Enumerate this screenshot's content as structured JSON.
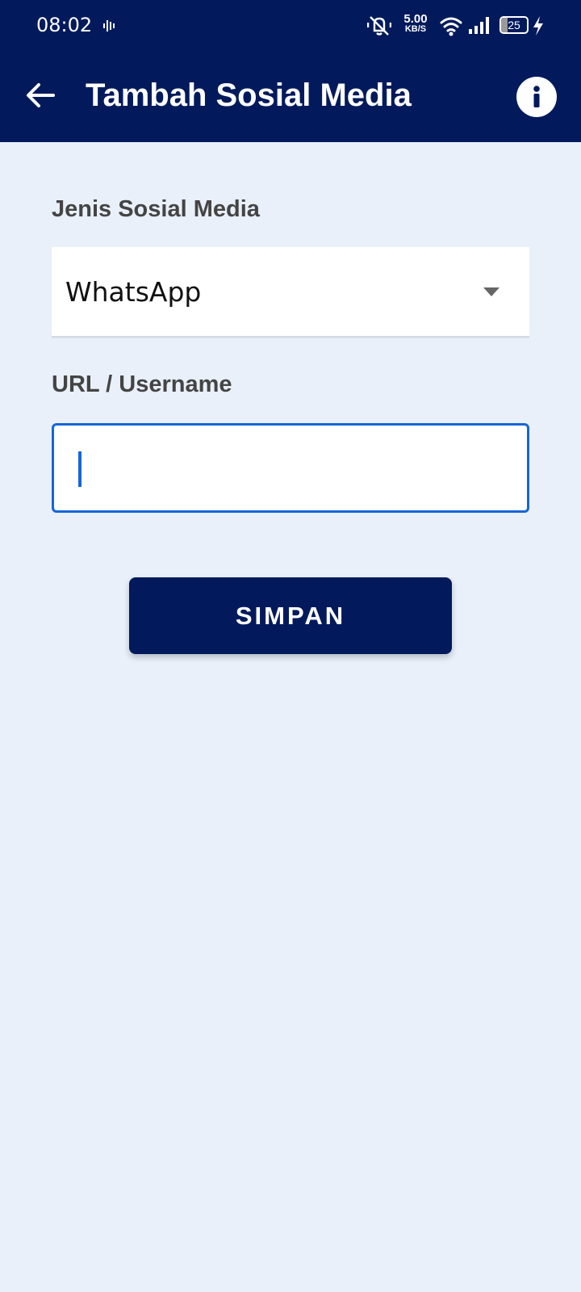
{
  "status_bar": {
    "time": "08:02",
    "network_speed_value": "5.00",
    "network_speed_unit": "KB/S",
    "battery_level": "25",
    "icons": [
      "voice-activity-icon",
      "mute-vibrate-icon",
      "wifi-icon",
      "signal-icon",
      "battery-icon",
      "charging-icon"
    ]
  },
  "app_bar": {
    "title": "Tambah Sosial Media",
    "back_icon": "arrow-left-icon",
    "info_icon": "info-icon"
  },
  "form": {
    "type_label": "Jenis Sosial Media",
    "type_value": "WhatsApp",
    "url_label": "URL / Username",
    "url_value": ""
  },
  "actions": {
    "save_label": "SIMPAN"
  },
  "colors": {
    "primary": "#021a5c",
    "background": "#e9f0fa",
    "focus": "#1466d9"
  }
}
